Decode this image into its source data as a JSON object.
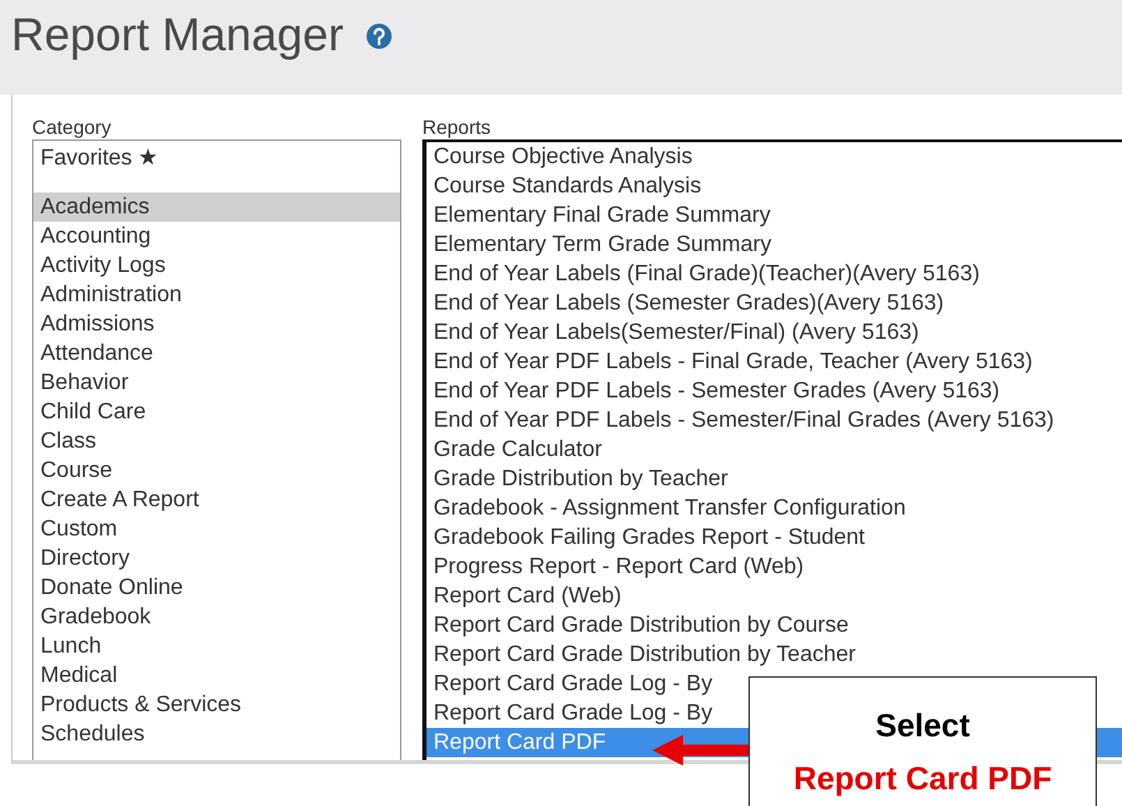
{
  "page": {
    "title": "Report Manager"
  },
  "category": {
    "label": "Category",
    "favorites": {
      "label": "Favorites ★",
      "selected": false
    },
    "items": [
      {
        "label": "Academics",
        "selected": true
      },
      {
        "label": "Accounting",
        "selected": false
      },
      {
        "label": "Activity Logs",
        "selected": false
      },
      {
        "label": "Administration",
        "selected": false
      },
      {
        "label": "Admissions",
        "selected": false
      },
      {
        "label": "Attendance",
        "selected": false
      },
      {
        "label": "Behavior",
        "selected": false
      },
      {
        "label": "Child Care",
        "selected": false
      },
      {
        "label": "Class",
        "selected": false
      },
      {
        "label": "Course",
        "selected": false
      },
      {
        "label": "Create A Report",
        "selected": false
      },
      {
        "label": "Custom",
        "selected": false
      },
      {
        "label": "Directory",
        "selected": false
      },
      {
        "label": "Donate Online",
        "selected": false
      },
      {
        "label": "Gradebook",
        "selected": false
      },
      {
        "label": "Lunch",
        "selected": false
      },
      {
        "label": "Medical",
        "selected": false
      },
      {
        "label": "Products & Services",
        "selected": false
      },
      {
        "label": "Schedules",
        "selected": false
      }
    ]
  },
  "reports": {
    "label": "Reports",
    "items": [
      {
        "label": "Course Objective Analysis",
        "selected": false
      },
      {
        "label": "Course Standards Analysis",
        "selected": false
      },
      {
        "label": "Elementary Final Grade Summary",
        "selected": false
      },
      {
        "label": "Elementary Term Grade Summary",
        "selected": false
      },
      {
        "label": "End of Year Labels (Final Grade)(Teacher)(Avery 5163)",
        "selected": false
      },
      {
        "label": "End of Year Labels (Semester Grades)(Avery 5163)",
        "selected": false
      },
      {
        "label": "End of Year Labels(Semester/Final) (Avery 5163)",
        "selected": false
      },
      {
        "label": "End of Year PDF Labels - Final Grade, Teacher (Avery 5163)",
        "selected": false
      },
      {
        "label": "End of Year PDF Labels - Semester Grades (Avery 5163)",
        "selected": false
      },
      {
        "label": "End of Year PDF Labels - Semester/Final Grades (Avery 5163)",
        "selected": false
      },
      {
        "label": "Grade Calculator",
        "selected": false
      },
      {
        "label": "Grade Distribution by Teacher",
        "selected": false
      },
      {
        "label": "Gradebook - Assignment Transfer Configuration",
        "selected": false
      },
      {
        "label": "Gradebook Failing Grades Report - Student",
        "selected": false
      },
      {
        "label": "Progress Report - Report Card (Web)",
        "selected": false
      },
      {
        "label": "Report Card (Web)",
        "selected": false
      },
      {
        "label": "Report Card Grade Distribution by Course",
        "selected": false
      },
      {
        "label": "Report Card Grade Distribution by Teacher",
        "selected": false
      },
      {
        "label": "Report Card Grade Log - By",
        "selected": false
      },
      {
        "label": "Report Card Grade Log - By",
        "selected": false
      },
      {
        "label": "Report Card PDF",
        "selected": true
      }
    ]
  },
  "callout": {
    "lines": [
      {
        "text": "Select",
        "kind": "instruction"
      },
      {
        "text": "Report Card PDF",
        "kind": "highlight"
      }
    ]
  }
}
